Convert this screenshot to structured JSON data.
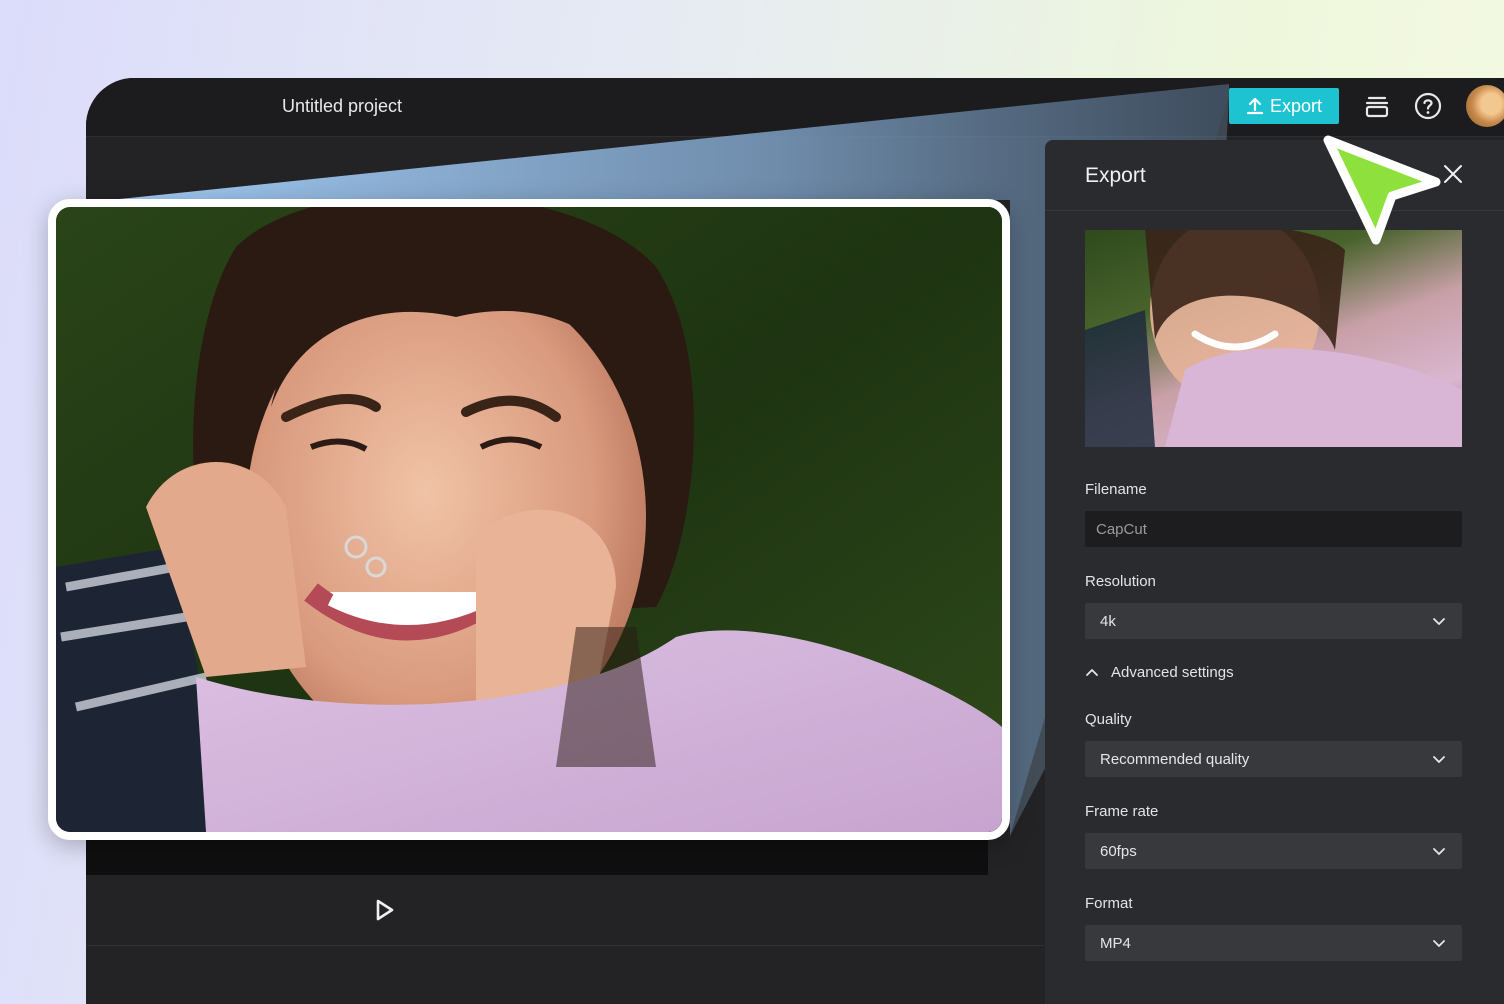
{
  "header": {
    "project_title": "Untitled project",
    "export_label": "Export"
  },
  "icons": {
    "export": "upload-icon",
    "layers": "layers-icon",
    "help": "help-circle-icon",
    "close": "close-icon",
    "play": "play-icon",
    "dropdown": "chevron-down-icon",
    "advanced_toggle": "chevron-up-icon"
  },
  "export_panel": {
    "title": "Export",
    "filename_label": "Filename",
    "filename_placeholder": "CapCut",
    "resolution_label": "Resolution",
    "resolution_value": "4k",
    "advanced_label": "Advanced settings",
    "quality_label": "Quality",
    "quality_value": "Recommended quality",
    "frame_rate_label": "Frame rate",
    "frame_rate_value": "60fps",
    "format_label": "Format",
    "format_value": "MP4"
  },
  "colors": {
    "accent": "#1ec3d2",
    "cursor": "#8ee03c",
    "panel_bg": "#2a2b2f",
    "app_bg": "#232326"
  }
}
